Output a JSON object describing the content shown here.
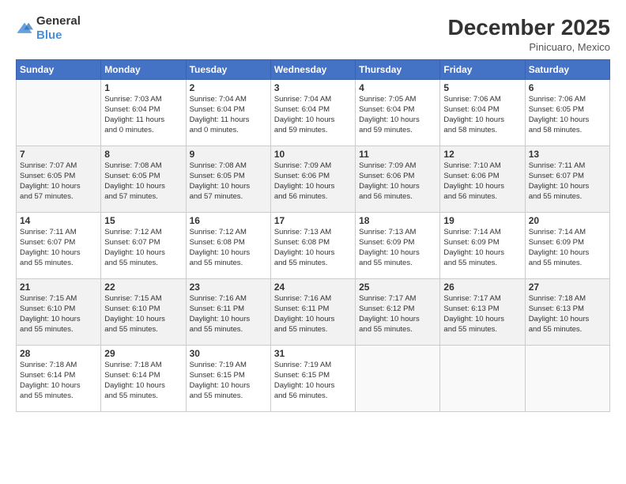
{
  "header": {
    "logo_general": "General",
    "logo_blue": "Blue",
    "month_title": "December 2025",
    "subtitle": "Pinicuaro, Mexico"
  },
  "weekdays": [
    "Sunday",
    "Monday",
    "Tuesday",
    "Wednesday",
    "Thursday",
    "Friday",
    "Saturday"
  ],
  "weeks": [
    [
      {
        "day": "",
        "info": ""
      },
      {
        "day": "1",
        "info": "Sunrise: 7:03 AM\nSunset: 6:04 PM\nDaylight: 11 hours\nand 0 minutes."
      },
      {
        "day": "2",
        "info": "Sunrise: 7:04 AM\nSunset: 6:04 PM\nDaylight: 11 hours\nand 0 minutes."
      },
      {
        "day": "3",
        "info": "Sunrise: 7:04 AM\nSunset: 6:04 PM\nDaylight: 10 hours\nand 59 minutes."
      },
      {
        "day": "4",
        "info": "Sunrise: 7:05 AM\nSunset: 6:04 PM\nDaylight: 10 hours\nand 59 minutes."
      },
      {
        "day": "5",
        "info": "Sunrise: 7:06 AM\nSunset: 6:04 PM\nDaylight: 10 hours\nand 58 minutes."
      },
      {
        "day": "6",
        "info": "Sunrise: 7:06 AM\nSunset: 6:05 PM\nDaylight: 10 hours\nand 58 minutes."
      }
    ],
    [
      {
        "day": "7",
        "info": "Sunrise: 7:07 AM\nSunset: 6:05 PM\nDaylight: 10 hours\nand 57 minutes."
      },
      {
        "day": "8",
        "info": "Sunrise: 7:08 AM\nSunset: 6:05 PM\nDaylight: 10 hours\nand 57 minutes."
      },
      {
        "day": "9",
        "info": "Sunrise: 7:08 AM\nSunset: 6:05 PM\nDaylight: 10 hours\nand 57 minutes."
      },
      {
        "day": "10",
        "info": "Sunrise: 7:09 AM\nSunset: 6:06 PM\nDaylight: 10 hours\nand 56 minutes."
      },
      {
        "day": "11",
        "info": "Sunrise: 7:09 AM\nSunset: 6:06 PM\nDaylight: 10 hours\nand 56 minutes."
      },
      {
        "day": "12",
        "info": "Sunrise: 7:10 AM\nSunset: 6:06 PM\nDaylight: 10 hours\nand 56 minutes."
      },
      {
        "day": "13",
        "info": "Sunrise: 7:11 AM\nSunset: 6:07 PM\nDaylight: 10 hours\nand 55 minutes."
      }
    ],
    [
      {
        "day": "14",
        "info": "Sunrise: 7:11 AM\nSunset: 6:07 PM\nDaylight: 10 hours\nand 55 minutes."
      },
      {
        "day": "15",
        "info": "Sunrise: 7:12 AM\nSunset: 6:07 PM\nDaylight: 10 hours\nand 55 minutes."
      },
      {
        "day": "16",
        "info": "Sunrise: 7:12 AM\nSunset: 6:08 PM\nDaylight: 10 hours\nand 55 minutes."
      },
      {
        "day": "17",
        "info": "Sunrise: 7:13 AM\nSunset: 6:08 PM\nDaylight: 10 hours\nand 55 minutes."
      },
      {
        "day": "18",
        "info": "Sunrise: 7:13 AM\nSunset: 6:09 PM\nDaylight: 10 hours\nand 55 minutes."
      },
      {
        "day": "19",
        "info": "Sunrise: 7:14 AM\nSunset: 6:09 PM\nDaylight: 10 hours\nand 55 minutes."
      },
      {
        "day": "20",
        "info": "Sunrise: 7:14 AM\nSunset: 6:09 PM\nDaylight: 10 hours\nand 55 minutes."
      }
    ],
    [
      {
        "day": "21",
        "info": "Sunrise: 7:15 AM\nSunset: 6:10 PM\nDaylight: 10 hours\nand 55 minutes."
      },
      {
        "day": "22",
        "info": "Sunrise: 7:15 AM\nSunset: 6:10 PM\nDaylight: 10 hours\nand 55 minutes."
      },
      {
        "day": "23",
        "info": "Sunrise: 7:16 AM\nSunset: 6:11 PM\nDaylight: 10 hours\nand 55 minutes."
      },
      {
        "day": "24",
        "info": "Sunrise: 7:16 AM\nSunset: 6:11 PM\nDaylight: 10 hours\nand 55 minutes."
      },
      {
        "day": "25",
        "info": "Sunrise: 7:17 AM\nSunset: 6:12 PM\nDaylight: 10 hours\nand 55 minutes."
      },
      {
        "day": "26",
        "info": "Sunrise: 7:17 AM\nSunset: 6:13 PM\nDaylight: 10 hours\nand 55 minutes."
      },
      {
        "day": "27",
        "info": "Sunrise: 7:18 AM\nSunset: 6:13 PM\nDaylight: 10 hours\nand 55 minutes."
      }
    ],
    [
      {
        "day": "28",
        "info": "Sunrise: 7:18 AM\nSunset: 6:14 PM\nDaylight: 10 hours\nand 55 minutes."
      },
      {
        "day": "29",
        "info": "Sunrise: 7:18 AM\nSunset: 6:14 PM\nDaylight: 10 hours\nand 55 minutes."
      },
      {
        "day": "30",
        "info": "Sunrise: 7:19 AM\nSunset: 6:15 PM\nDaylight: 10 hours\nand 55 minutes."
      },
      {
        "day": "31",
        "info": "Sunrise: 7:19 AM\nSunset: 6:15 PM\nDaylight: 10 hours\nand 56 minutes."
      },
      {
        "day": "",
        "info": ""
      },
      {
        "day": "",
        "info": ""
      },
      {
        "day": "",
        "info": ""
      }
    ]
  ]
}
